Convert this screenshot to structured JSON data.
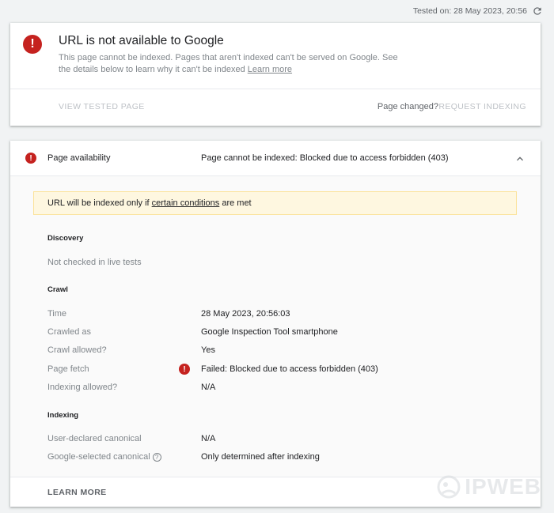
{
  "header": {
    "tested_on": "Tested on: 28 May 2023, 20:56"
  },
  "summary": {
    "title": "URL is not available to Google",
    "description": "This page cannot be indexed. Pages that aren't indexed can't be served on Google. See the details below to learn why it can't be indexed",
    "learn_more_link": "Learn more",
    "view_tested_page": "VIEW TESTED PAGE",
    "page_changed": "Page changed?",
    "request_indexing": "REQUEST INDEXING"
  },
  "availability": {
    "label": "Page availability",
    "status": "Page cannot be indexed: Blocked due to access forbidden (403)",
    "notice_pre": "URL will be indexed only if ",
    "notice_link": "certain conditions",
    "notice_post": " are met"
  },
  "discovery": {
    "heading": "Discovery",
    "text": "Not checked in live tests"
  },
  "crawl": {
    "heading": "Crawl",
    "rows": [
      {
        "label": "Time",
        "value": "28 May 2023, 20:56:03"
      },
      {
        "label": "Crawled as",
        "value": "Google Inspection Tool smartphone"
      },
      {
        "label": "Crawl allowed?",
        "value": "Yes"
      },
      {
        "label": "Page fetch",
        "value": "Failed: Blocked due to access forbidden (403)"
      },
      {
        "label": "Indexing allowed?",
        "value": "N/A"
      }
    ]
  },
  "indexing": {
    "heading": "Indexing",
    "rows": [
      {
        "label": "User-declared canonical",
        "value": "N/A"
      },
      {
        "label": "Google-selected canonical",
        "value": "Only determined after indexing"
      }
    ]
  },
  "footer": {
    "learn_more": "LEARN MORE"
  },
  "watermark": {
    "text": "IPWEB"
  },
  "colors": {
    "error": "#c5221f",
    "notice_bg": "#fef7e0",
    "muted": "#80868b"
  }
}
